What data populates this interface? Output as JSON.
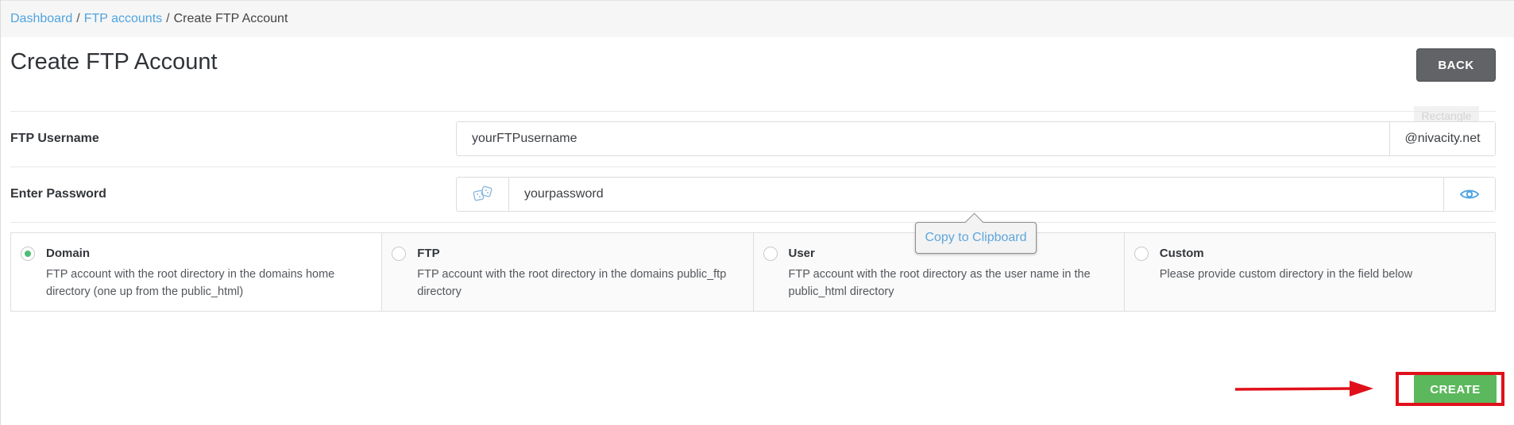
{
  "breadcrumb": {
    "items": [
      "Dashboard",
      "FTP accounts"
    ],
    "separator": "/",
    "current": "Create FTP Account"
  },
  "page": {
    "title": "Create FTP Account",
    "back_label": "BACK",
    "ghost_tooltip": "Rectangle"
  },
  "form": {
    "username": {
      "label": "FTP Username",
      "value": "yourFTPusername",
      "suffix": "@nivacity.net"
    },
    "password": {
      "label": "Enter Password",
      "value": "yourpassword",
      "generate_icon": "dice-icon",
      "toggle_icon": "eye-icon"
    },
    "copy_tooltip": "Copy to Clipboard"
  },
  "directory_options": [
    {
      "title": "Domain",
      "description": "FTP account with the root directory in the domains home directory (one up from the public_html)",
      "selected": true
    },
    {
      "title": "FTP",
      "description": "FTP account with the root directory in the domains public_ftp directory",
      "selected": false
    },
    {
      "title": "User",
      "description": "FTP account with the root directory as the user name in the public_html directory",
      "selected": false
    },
    {
      "title": "Custom",
      "description": "Please provide custom directory in the field below",
      "selected": false
    }
  ],
  "actions": {
    "create_label": "CREATE"
  },
  "colors": {
    "link": "#4fa4e0",
    "back_button": "#616366",
    "create_button": "#5cb85c",
    "radio_selected": "#4dbd74",
    "annotation": "#e0101a"
  }
}
